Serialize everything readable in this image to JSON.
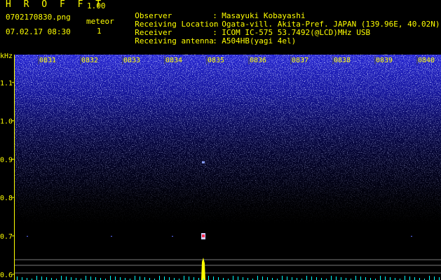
{
  "header": {
    "app_name": "H R O F F T",
    "version": "1.00",
    "filename": "0702170830.png",
    "datetime": "07.02.17 08:30",
    "meteor_label": "meteor",
    "meteor_count": "1"
  },
  "info": [
    {
      "key": "Observer",
      "value": "Masayuki Kobayashi"
    },
    {
      "key": "Receiving Location",
      "value": "Ogata-vill. Akita-Pref. JAPAN (139.96E, 40.02N)"
    },
    {
      "key": "Receiver",
      "value": "ICOM IC-575 53.7492(@LCD)MHz USB"
    },
    {
      "key": "Receiving antenna",
      "value": "A504HB(yagi 4el)"
    }
  ],
  "colors": {
    "header_text": "#ffff00",
    "background_noise": "#1c1cc8",
    "detection": "#ffff00",
    "axis": "#ffff00",
    "baseline": "#00ffff"
  },
  "chart_data": {
    "type": "heatmap",
    "xlabel": "",
    "ylabel": "kHz",
    "x_ticks": [
      "0831",
      "0832",
      "0833",
      "0834",
      "0835",
      "0836",
      "0837",
      "0838",
      "0839",
      "0840"
    ],
    "y_ticks": [
      "1.1",
      "1.0",
      "0.9",
      "0.8",
      "0.7",
      "0.6"
    ],
    "y_values": [
      1.1,
      1.0,
      0.9,
      0.8,
      0.7,
      0.6
    ],
    "ylim": [
      0.585,
      1.18
    ],
    "xlim": [
      "0830",
      "0840"
    ],
    "meteor_events": [
      {
        "time": "08:34.7",
        "freq_khz": 0.7
      }
    ],
    "detections": [
      {
        "time": "08:34.7",
        "freq_khz": 0.9
      }
    ]
  }
}
